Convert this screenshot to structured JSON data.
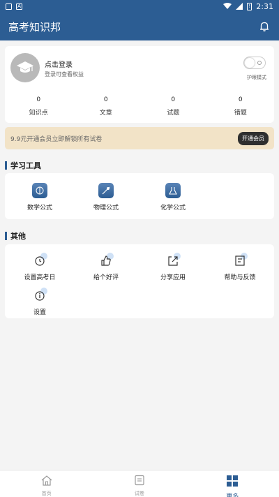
{
  "status_bar": {
    "time": "2:31",
    "battery": "!"
  },
  "app": {
    "title": "高考知识邦"
  },
  "login": {
    "title": "点击登录",
    "subtitle": "登录可查看权益",
    "toggle_label": "护眼模式",
    "toggle_on": false
  },
  "stats": [
    {
      "value": "0",
      "label": "知识点"
    },
    {
      "value": "0",
      "label": "文章"
    },
    {
      "value": "0",
      "label": "试题"
    },
    {
      "value": "0",
      "label": "错题"
    }
  ],
  "banner": {
    "text": "9.9元开通会员立即解锁所有试卷",
    "button": "开通会员"
  },
  "tools": {
    "title": "学习工具",
    "items": [
      {
        "label": "数学公式",
        "icon": "math-formula-icon"
      },
      {
        "label": "物理公式",
        "icon": "physics-formula-icon"
      },
      {
        "label": "化学公式",
        "icon": "chemistry-formula-icon"
      }
    ]
  },
  "others": {
    "title": "其他",
    "items": [
      {
        "label": "设置高考日",
        "icon": "alarm-clock-icon"
      },
      {
        "label": "给个好评",
        "icon": "thumbs-up-icon"
      },
      {
        "label": "分享应用",
        "icon": "share-icon"
      },
      {
        "label": "帮助与反馈",
        "icon": "feedback-icon"
      },
      {
        "label": "设置",
        "icon": "settings-icon"
      }
    ]
  },
  "nav": [
    {
      "label": "首页",
      "icon": "home-icon"
    },
    {
      "label": "试卷",
      "icon": "paper-icon"
    },
    {
      "label": "更多",
      "icon": "more-grid-icon"
    }
  ],
  "colors": {
    "primary": "#2c5d93",
    "banner_bg": "#f2e3c7",
    "page_bg": "#f4f4f4",
    "icon_halo": "#cfe1f6"
  }
}
